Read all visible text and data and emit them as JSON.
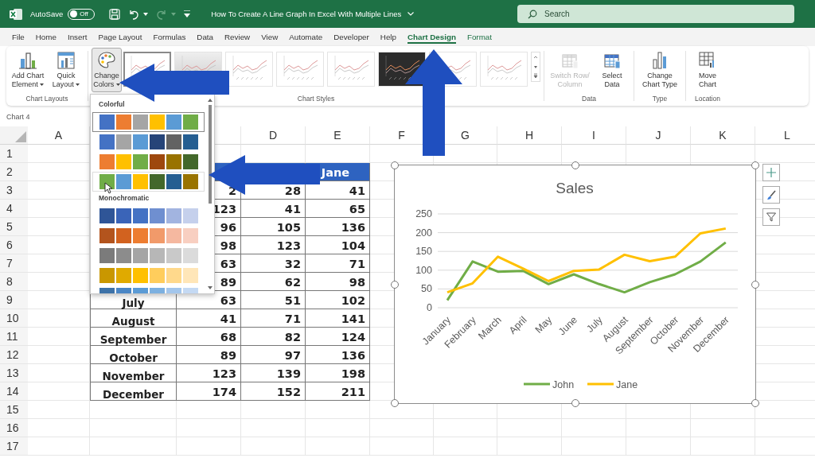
{
  "title_bar": {
    "autosave_label": "AutoSave",
    "autosave": {
      "on": false,
      "text": "Off"
    },
    "document_title": "How To Create A Line Graph In Excel With Multiple Lines",
    "search": {
      "placeholder": "Search"
    }
  },
  "tabs": [
    {
      "label": "File",
      "selected": false,
      "contextual": false
    },
    {
      "label": "Home",
      "selected": false,
      "contextual": false
    },
    {
      "label": "Insert",
      "selected": false,
      "contextual": false
    },
    {
      "label": "Page Layout",
      "selected": false,
      "contextual": false
    },
    {
      "label": "Formulas",
      "selected": false,
      "contextual": false
    },
    {
      "label": "Data",
      "selected": false,
      "contextual": false
    },
    {
      "label": "Review",
      "selected": false,
      "contextual": false
    },
    {
      "label": "View",
      "selected": false,
      "contextual": false
    },
    {
      "label": "Automate",
      "selected": false,
      "contextual": false
    },
    {
      "label": "Developer",
      "selected": false,
      "contextual": false
    },
    {
      "label": "Help",
      "selected": false,
      "contextual": false
    },
    {
      "label": "Chart Design",
      "selected": true,
      "contextual": true
    },
    {
      "label": "Format",
      "selected": false,
      "contextual": true
    }
  ],
  "ribbon": {
    "chart_layouts": {
      "label": "Chart Layouts",
      "buttons": [
        {
          "label": "Add Chart Element"
        },
        {
          "label": "Quick Layout"
        }
      ]
    },
    "chart_styles": {
      "label": "Chart Styles",
      "change_colors": {
        "label": "Change Colors",
        "pressed": true
      },
      "styles": [
        {
          "kind": "light",
          "selected": true
        },
        {
          "kind": "grey",
          "selected": false
        },
        {
          "kind": "light",
          "selected": false
        },
        {
          "kind": "light",
          "selected": false
        },
        {
          "kind": "light",
          "selected": false
        },
        {
          "kind": "dark",
          "selected": false
        },
        {
          "kind": "light",
          "selected": false
        },
        {
          "kind": "light",
          "selected": false
        }
      ]
    },
    "data": {
      "label": "Data",
      "buttons": [
        {
          "label": "Switch Row/ Column",
          "disabled": true
        },
        {
          "label": "Select Data",
          "disabled": false
        }
      ]
    },
    "type": {
      "label": "Type",
      "button": "Change Chart Type"
    },
    "location": {
      "label": "Location",
      "button": "Move Chart"
    }
  },
  "name_box": "Chart 4",
  "sheet": {
    "columns": [
      "A",
      "D",
      "E",
      "F",
      "G",
      "H",
      "I",
      "J",
      "K",
      "L"
    ],
    "rows": [
      "1",
      "2",
      "3",
      "4",
      "5",
      "6",
      "7",
      "8",
      "9",
      "10",
      "11",
      "12",
      "13",
      "14",
      "15",
      "16",
      "17"
    ],
    "table": {
      "header": {
        "column_e": "Jane"
      },
      "rows": [
        {
          "column_c": "2",
          "column_d": "28",
          "column_e": "41"
        },
        {
          "column_c": "123",
          "column_d": "41",
          "column_e": "65"
        },
        {
          "column_c": "96",
          "column_d": "105",
          "column_e": "136"
        },
        {
          "column_c": "98",
          "column_d": "123",
          "column_e": "104"
        },
        {
          "column_c": "63",
          "column_d": "32",
          "column_e": "71"
        },
        {
          "column_c": "89",
          "column_d": "62",
          "column_e": "98"
        },
        {
          "column_b": "July",
          "column_c": "63",
          "column_d": "51",
          "column_e": "102"
        },
        {
          "column_b": "August",
          "column_c": "41",
          "column_d": "71",
          "column_e": "141"
        },
        {
          "column_b": "September",
          "column_c": "68",
          "column_d": "82",
          "column_e": "124"
        },
        {
          "column_b": "October",
          "column_c": "89",
          "column_d": "97",
          "column_e": "136"
        },
        {
          "column_b": "November",
          "column_c": "123",
          "column_d": "139",
          "column_e": "198"
        },
        {
          "column_b": "December",
          "column_c": "174",
          "column_d": "152",
          "column_e": "211"
        }
      ]
    }
  },
  "chart": {
    "chart_data": {
      "type": "line",
      "title": "Sales",
      "categories": [
        "January",
        "February",
        "March",
        "April",
        "May",
        "June",
        "July",
        "August",
        "September",
        "October",
        "November",
        "December"
      ],
      "series": [
        {
          "name": "John",
          "color": "#70ad47",
          "values": [
            20,
            123,
            96,
            98,
            63,
            89,
            63,
            41,
            68,
            89,
            123,
            174
          ]
        },
        {
          "name": "Jane",
          "color": "#ffc000",
          "values": [
            41,
            65,
            136,
            104,
            71,
            98,
            102,
            141,
            124,
            136,
            198,
            211
          ]
        }
      ],
      "ylim": [
        0,
        250
      ],
      "yticks": [
        0,
        50,
        100,
        150,
        200,
        250
      ],
      "grid": true,
      "legend": true
    }
  },
  "colors_menu": {
    "sections": [
      {
        "title": "Colorful",
        "palettes": [
          {
            "selected": true,
            "hovered": false,
            "swatches": [
              {
                "color": "#4472c4"
              },
              {
                "color": "#ed7d31"
              },
              {
                "color": "#a5a5a5"
              },
              {
                "color": "#ffc000"
              },
              {
                "color": "#5b9bd5"
              },
              {
                "color": "#70ad47"
              }
            ]
          },
          {
            "selected": false,
            "hovered": false,
            "swatches": [
              {
                "color": "#4472c4"
              },
              {
                "color": "#a5a5a5"
              },
              {
                "color": "#5b9bd5"
              },
              {
                "color": "#264478"
              },
              {
                "color": "#636363"
              },
              {
                "color": "#255e91"
              }
            ]
          },
          {
            "selected": false,
            "hovered": false,
            "swatches": [
              {
                "color": "#ed7d31"
              },
              {
                "color": "#ffc000"
              },
              {
                "color": "#70ad47"
              },
              {
                "color": "#9e480e"
              },
              {
                "color": "#997300"
              },
              {
                "color": "#43682b"
              }
            ]
          },
          {
            "selected": false,
            "hovered": true,
            "swatches": [
              {
                "color": "#70ad47"
              },
              {
                "color": "#5b9bd5"
              },
              {
                "color": "#ffc000"
              },
              {
                "color": "#43682b"
              },
              {
                "color": "#255e91"
              },
              {
                "color": "#997300"
              }
            ]
          }
        ]
      },
      {
        "title": "Monochromatic",
        "palettes": [
          {
            "selected": false,
            "hovered": false,
            "swatches": [
              {
                "color": "#2f5597"
              },
              {
                "color": "#3a64b8"
              },
              {
                "color": "#4472c4"
              },
              {
                "color": "#6f8fd0"
              },
              {
                "color": "#a2b4e0"
              },
              {
                "color": "#c5d0ec"
              }
            ]
          },
          {
            "selected": false,
            "hovered": false,
            "swatches": [
              {
                "color": "#b3541d"
              },
              {
                "color": "#d2621f"
              },
              {
                "color": "#ed7d31"
              },
              {
                "color": "#f19a6a"
              },
              {
                "color": "#f5b8a0"
              },
              {
                "color": "#f8cfc1"
              }
            ]
          },
          {
            "selected": false,
            "hovered": false,
            "swatches": [
              {
                "color": "#7b7b7b"
              },
              {
                "color": "#8c8c8c"
              },
              {
                "color": "#a5a5a5"
              },
              {
                "color": "#b7b7b7"
              },
              {
                "color": "#c9c9c9"
              },
              {
                "color": "#dbdbdb"
              }
            ]
          },
          {
            "selected": false,
            "hovered": false,
            "swatches": [
              {
                "color": "#c99700"
              },
              {
                "color": "#e0aa00"
              },
              {
                "color": "#ffc000"
              },
              {
                "color": "#ffcd5c"
              },
              {
                "color": "#ffd98c"
              },
              {
                "color": "#ffe6b8"
              }
            ]
          },
          {
            "selected": false,
            "hovered": false,
            "swatches": [
              {
                "color": "#3d72a8"
              },
              {
                "color": "#4a86c5"
              },
              {
                "color": "#5b9bd5"
              },
              {
                "color": "#7cb0e0"
              },
              {
                "color": "#a3c6ec"
              },
              {
                "color": "#c4d9f3"
              }
            ]
          }
        ]
      }
    ]
  }
}
